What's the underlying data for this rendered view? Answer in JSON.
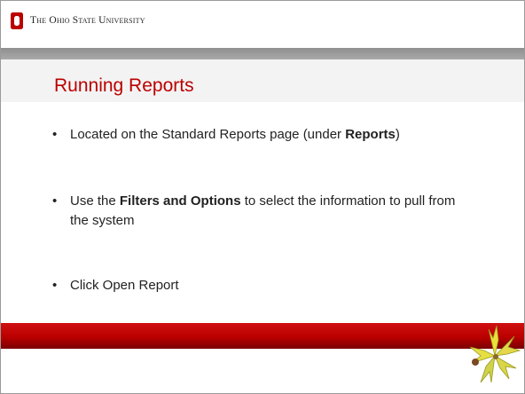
{
  "header": {
    "university_name": "The Ohio State University"
  },
  "slide": {
    "title": "Running Reports",
    "bullets": [
      {
        "parts": [
          {
            "text": "Located on the Standard Reports page (under ",
            "bold": false
          },
          {
            "text": "Reports",
            "bold": true
          },
          {
            "text": ")",
            "bold": false
          }
        ]
      },
      {
        "parts": [
          {
            "text": "Use the ",
            "bold": false
          },
          {
            "text": "Filters and Options",
            "bold": true
          },
          {
            "text": " to select the information to pull from the system",
            "bold": false
          }
        ]
      },
      {
        "parts": [
          {
            "text": "Click Open Report",
            "bold": false
          }
        ]
      }
    ]
  },
  "icons": {
    "logo": "block-o-logo-icon",
    "decoration": "buckeye-leaf-icon"
  },
  "colors": {
    "scarlet": "#bb0000",
    "gray": "#a0a0a0",
    "text": "#222222"
  }
}
